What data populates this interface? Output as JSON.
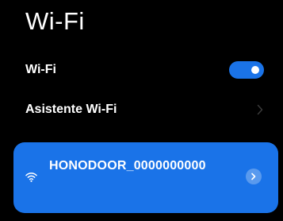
{
  "header": {
    "title": "Wi-Fi"
  },
  "settings": {
    "wifi_toggle_label": "Wi-Fi",
    "wifi_enabled": true,
    "assistant_label": "Asistente Wi-Fi"
  },
  "network": {
    "ssid": "HONODOOR_0000000000",
    "connected": true,
    "icon": "wifi-icon"
  },
  "colors": {
    "accent": "#1a73e8",
    "background": "#000000",
    "text": "#ffffff"
  }
}
